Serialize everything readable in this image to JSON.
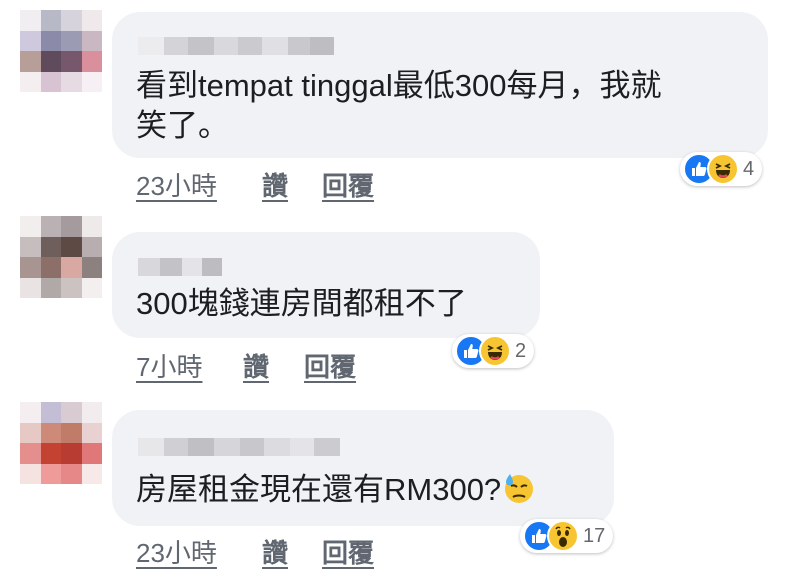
{
  "actions": {
    "like_label": "讚",
    "reply_label": "回覆"
  },
  "colors": {
    "like_blue": "#1877f2",
    "emoji_yellow": "#f7c531",
    "bubble_bg": "#f0f2f5",
    "meta_gray": "#606770"
  },
  "comments": [
    {
      "text": "看到tempat tinggal最低300每月，我就\n笑了。",
      "time": "23小時",
      "reactions": {
        "icons": [
          "like-icon",
          "haha-icon"
        ],
        "count": "4"
      }
    },
    {
      "text": "300塊錢連房間都租不了",
      "time": "7小時",
      "reactions": {
        "icons": [
          "like-icon",
          "haha-icon"
        ],
        "count": "2"
      }
    },
    {
      "text": "房屋租金現在還有RM300?",
      "text_emoji": "downcast-face-with-sweat-emoji",
      "time": "23小時",
      "reactions": {
        "icons": [
          "like-icon",
          "wow-icon"
        ],
        "count": "17"
      }
    }
  ]
}
